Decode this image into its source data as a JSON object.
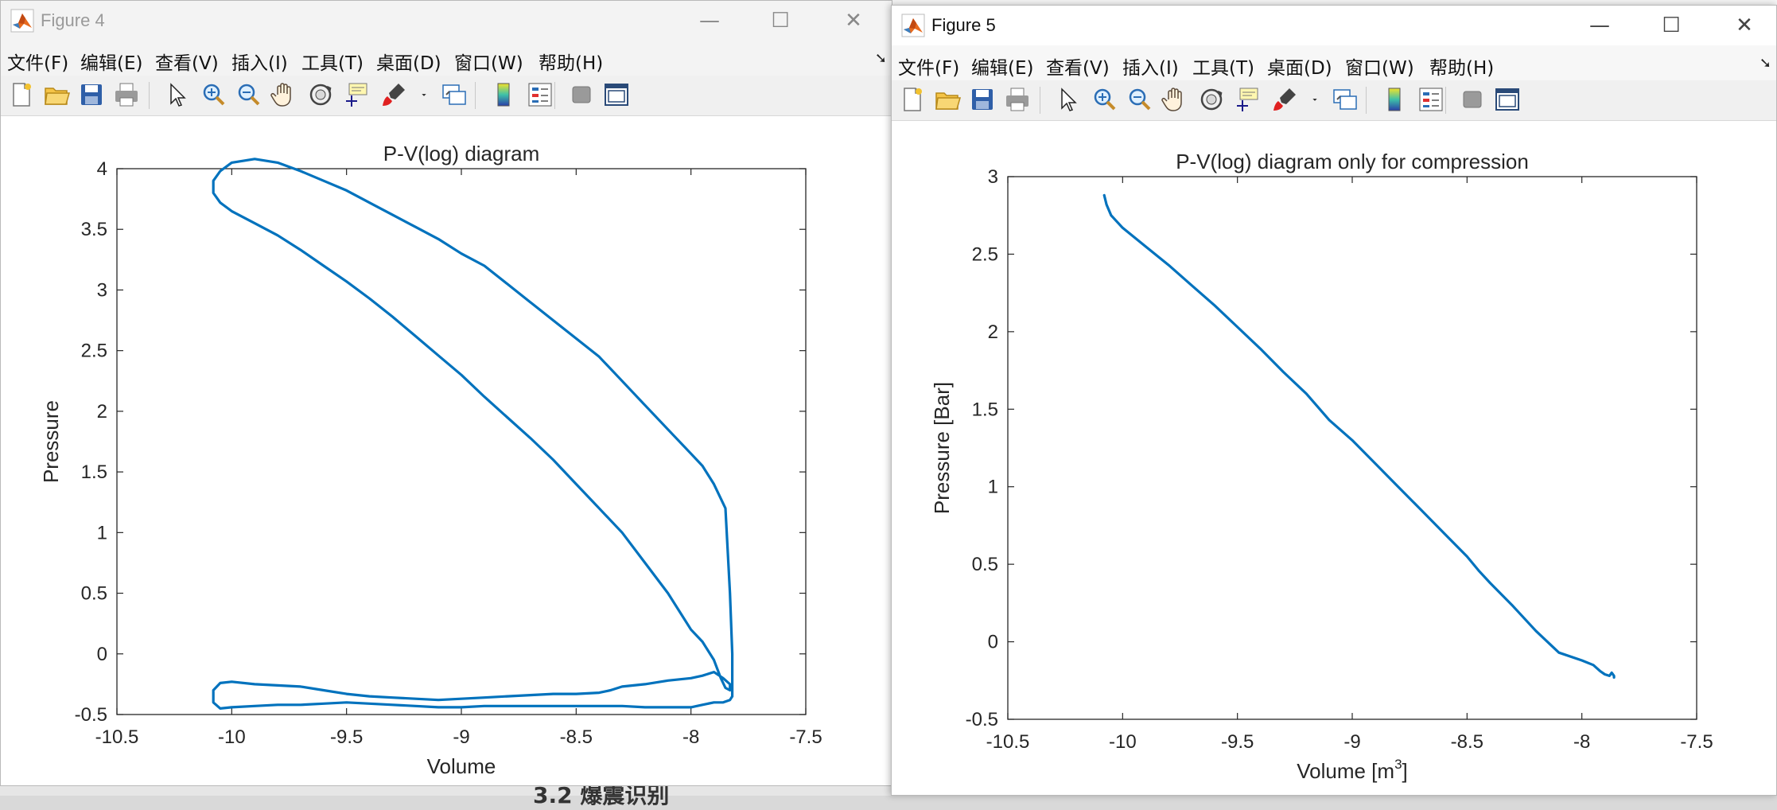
{
  "background": {
    "document_text": "3.2 爆震识别"
  },
  "menu": [
    "文件(F)",
    "编辑(E)",
    "查看(V)",
    "插入(I)",
    "工具(T)",
    "桌面(D)",
    "窗口(W)",
    "帮助(H)"
  ],
  "toolbar_icons": [
    "new-figure-icon",
    "open-file-icon",
    "save-icon",
    "print-icon",
    "pointer-icon",
    "zoom-in-icon",
    "zoom-out-icon",
    "pan-hand-icon",
    "rotate-3d-icon",
    "data-cursor-icon",
    "brush-icon",
    "brush-dropdown-icon",
    "link-plot-icon",
    "colorbar-icon",
    "legend-icon",
    "hide-plot-tools-icon",
    "show-plot-tools-icon"
  ],
  "colors": {
    "line": "#0072BD",
    "axes": "#262626",
    "title_inactive": "#9a9a9a",
    "title_active": "#111111"
  },
  "figure4": {
    "title": "Figure 4",
    "window_controls": {
      "minimize": "—",
      "maximize": "☐",
      "close": "✕"
    },
    "chart_data": {
      "type": "line",
      "title": "P-V(log) diagram",
      "xlabel": "Volume",
      "ylabel": "Pressure",
      "xlim": [
        -10.5,
        -7.5
      ],
      "ylim": [
        -0.5,
        4
      ],
      "xticks": [
        "-10.5",
        "-10",
        "-9.5",
        "-9",
        "-8.5",
        "-8",
        "-7.5"
      ],
      "yticks": [
        "-0.5",
        "0",
        "0.5",
        "1",
        "1.5",
        "2",
        "2.5",
        "3",
        "3.5",
        "4"
      ],
      "grid": false,
      "series": [
        {
          "x": [
            -7.82,
            -7.82,
            -7.82,
            -7.83,
            -7.85,
            -7.9,
            -7.95,
            -8.0,
            -8.1,
            -8.2,
            -8.3,
            -8.4,
            -8.5,
            -8.6,
            -8.7,
            -8.8,
            -8.9,
            -9.0,
            -9.1,
            -9.2,
            -9.3,
            -9.4,
            -9.5,
            -9.6,
            -9.7,
            -9.8,
            -9.9,
            -10.0,
            -10.05,
            -10.08,
            -10.08,
            -10.05,
            -10.0,
            -9.9,
            -9.8,
            -9.7,
            -9.6,
            -9.5,
            -9.4,
            -9.3,
            -9.2,
            -9.1,
            -9.0,
            -8.9,
            -8.8,
            -8.7,
            -8.6,
            -8.5,
            -8.4,
            -8.3,
            -8.2,
            -8.1,
            -8.05,
            -8.0,
            -7.95,
            -7.9,
            -7.87,
            -7.85,
            -7.83,
            -7.83,
            -7.86,
            -7.9,
            -7.95,
            -8.0,
            -8.1,
            -8.2,
            -8.3,
            -8.35,
            -8.4,
            -8.5,
            -8.6,
            -8.7,
            -8.8,
            -8.9,
            -9.0,
            -9.1,
            -9.2,
            -9.3,
            -9.4,
            -9.5,
            -9.6,
            -9.7,
            -9.8,
            -9.9,
            -10.0,
            -10.05,
            -10.08,
            -10.08,
            -10.05,
            -10.0,
            -9.9,
            -9.8,
            -9.7,
            -9.6,
            -9.5,
            -9.4,
            -9.3,
            -9.2,
            -9.1,
            -9.0,
            -8.9,
            -8.8,
            -8.7,
            -8.6,
            -8.5,
            -8.4,
            -8.3,
            -8.2,
            -8.1,
            -8.0,
            -7.95,
            -7.9,
            -7.86,
            -7.83,
            -7.82
          ],
          "y": [
            -0.35,
            -0.2,
            0.0,
            0.5,
            1.2,
            1.4,
            1.55,
            1.65,
            1.85,
            2.05,
            2.25,
            2.45,
            2.6,
            2.75,
            2.9,
            3.05,
            3.2,
            3.3,
            3.42,
            3.52,
            3.62,
            3.72,
            3.82,
            3.9,
            3.98,
            4.05,
            4.08,
            4.05,
            3.98,
            3.9,
            3.8,
            3.72,
            3.65,
            3.55,
            3.45,
            3.33,
            3.2,
            3.07,
            2.93,
            2.78,
            2.62,
            2.46,
            2.3,
            2.12,
            1.95,
            1.78,
            1.6,
            1.4,
            1.2,
            1.0,
            0.75,
            0.5,
            0.35,
            0.2,
            0.1,
            -0.05,
            -0.2,
            -0.28,
            -0.3,
            -0.25,
            -0.2,
            -0.15,
            -0.18,
            -0.2,
            -0.22,
            -0.25,
            -0.27,
            -0.3,
            -0.32,
            -0.33,
            -0.33,
            -0.34,
            -0.35,
            -0.36,
            -0.37,
            -0.38,
            -0.37,
            -0.36,
            -0.35,
            -0.33,
            -0.3,
            -0.27,
            -0.26,
            -0.25,
            -0.23,
            -0.24,
            -0.3,
            -0.4,
            -0.45,
            -0.44,
            -0.43,
            -0.42,
            -0.42,
            -0.41,
            -0.4,
            -0.41,
            -0.42,
            -0.43,
            -0.44,
            -0.44,
            -0.43,
            -0.43,
            -0.43,
            -0.43,
            -0.43,
            -0.43,
            -0.43,
            -0.44,
            -0.44,
            -0.44,
            -0.42,
            -0.4,
            -0.4,
            -0.38,
            -0.35
          ]
        }
      ]
    }
  },
  "figure5": {
    "title": "Figure 5",
    "window_controls": {
      "minimize": "—",
      "maximize": "☐",
      "close": "✕"
    },
    "chart_data": {
      "type": "line",
      "title": "P-V(log) diagram only for compression",
      "xlabel": "Volume [m",
      "xlabel_sup": "3",
      "xlabel_end": "]",
      "ylabel": "Pressure [Bar]",
      "xlim": [
        -10.5,
        -7.5
      ],
      "ylim": [
        -0.5,
        3
      ],
      "xticks": [
        "-10.5",
        "-10",
        "-9.5",
        "-9",
        "-8.5",
        "-8",
        "-7.5"
      ],
      "yticks": [
        "-0.5",
        "0",
        "0.5",
        "1",
        "1.5",
        "2",
        "2.5",
        "3"
      ],
      "grid": false,
      "series": [
        {
          "x": [
            -10.08,
            -10.07,
            -10.05,
            -10.0,
            -9.9,
            -9.8,
            -9.7,
            -9.6,
            -9.5,
            -9.4,
            -9.3,
            -9.2,
            -9.1,
            -9.0,
            -8.9,
            -8.8,
            -8.7,
            -8.6,
            -8.5,
            -8.45,
            -8.4,
            -8.3,
            -8.2,
            -8.1,
            -8.0,
            -7.95,
            -7.92,
            -7.9,
            -7.88,
            -7.87,
            -7.86,
            -7.86
          ],
          "y": [
            2.88,
            2.82,
            2.75,
            2.67,
            2.55,
            2.43,
            2.3,
            2.17,
            2.03,
            1.89,
            1.74,
            1.6,
            1.43,
            1.3,
            1.15,
            1.0,
            0.85,
            0.7,
            0.55,
            0.46,
            0.38,
            0.23,
            0.07,
            -0.07,
            -0.12,
            -0.15,
            -0.19,
            -0.21,
            -0.22,
            -0.2,
            -0.22,
            -0.23
          ]
        }
      ]
    }
  }
}
